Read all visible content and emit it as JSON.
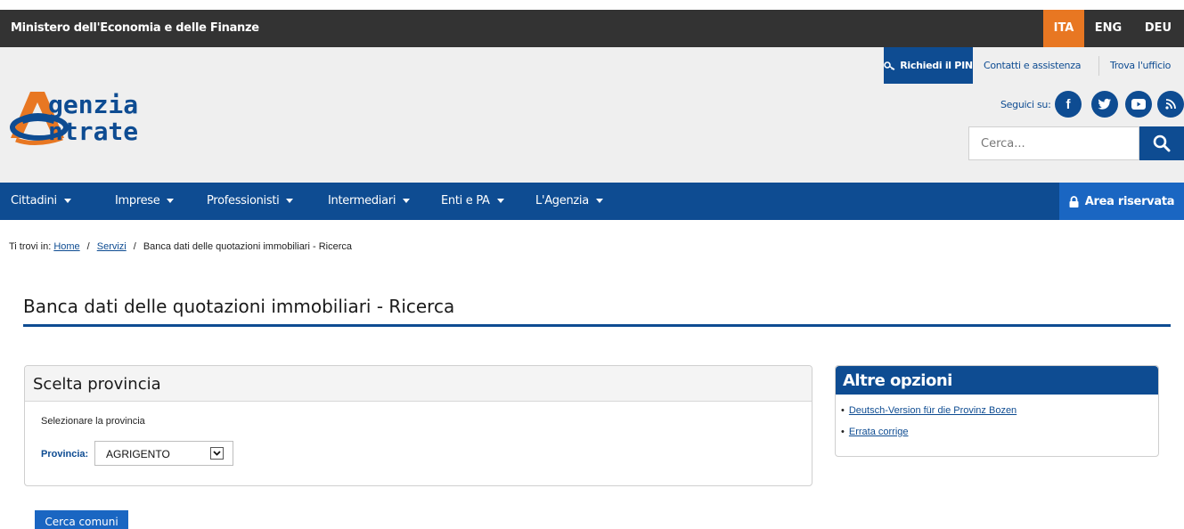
{
  "topbar": {
    "ministry": "Ministero dell'Economia e delle Finanze",
    "languages": [
      "ITA",
      "ENG",
      "DEU"
    ],
    "active_language": "ITA"
  },
  "header": {
    "logo_line1": "genzia",
    "logo_line2": "ntrate",
    "pin_button": "Richiedi il PIN",
    "contatti": "Contatti e assistenza",
    "trova": "Trova l'ufficio",
    "follow_label": "Seguici su:",
    "social": [
      "facebook-icon",
      "twitter-icon",
      "youtube-icon",
      "rss-icon"
    ],
    "search_placeholder": "Cerca..."
  },
  "nav": {
    "items": [
      "Cittadini",
      "Imprese",
      "Professionisti",
      "Intermediari",
      "Enti e PA",
      "L'Agenzia"
    ],
    "area_riservata": "Area riservata"
  },
  "breadcrumb": {
    "prefix": "Ti trovi in:",
    "home": "Home",
    "servizi": "Servizi",
    "current": "Banca dati delle quotazioni immobiliari - Ricerca"
  },
  "page": {
    "title": "Banca dati delle quotazioni immobiliari - Ricerca"
  },
  "panel": {
    "title": "Scelta provincia",
    "hint": "Selezionare la provincia",
    "provincia_label": "Provincia:",
    "provincia_value": "AGRIGENTO"
  },
  "side": {
    "title": "Altre opzioni",
    "links": [
      "Deutsch-Version für die Provinz Bozen",
      "Errata corrige"
    ]
  },
  "actions": {
    "cerca_comuni": "Cerca comuni"
  },
  "colors": {
    "brand_blue": "#0e4c92",
    "accent_blue": "#1a66c2",
    "lang_active": "#e87722",
    "topbar": "#333333"
  }
}
